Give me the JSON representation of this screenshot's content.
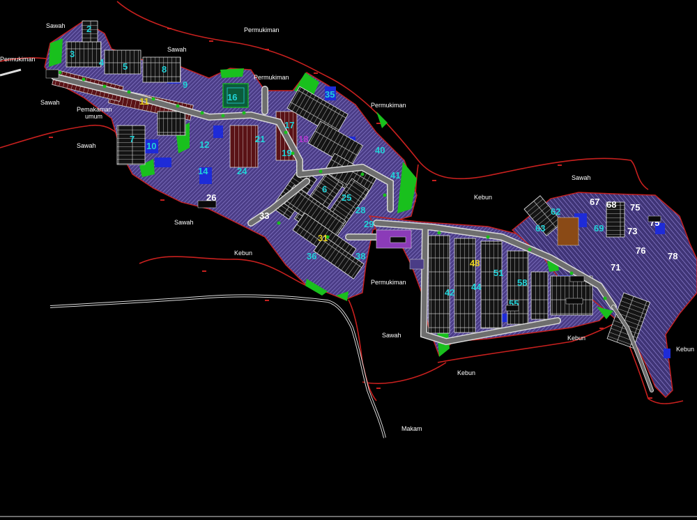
{
  "labels": {
    "sawah_1": "Sawah",
    "sawah_2": "Sawah",
    "sawah_3": "Sawah",
    "sawah_4": "Sawah",
    "sawah_5": "Sawah",
    "sawah_6": "Sawah",
    "sawah_7": "Sawah",
    "permukiman_1": "Permukiman",
    "permukiman_2": "Permukiman",
    "permukiman_3": "Permukiman",
    "permukiman_4": "Permukiman",
    "permukiman_5": "Permukiman",
    "pemakaman_line1": "Pemakaman",
    "pemakaman_line2": "umum",
    "kebun_1": "Kebun",
    "kebun_2": "Kebun",
    "kebun_3": "Kebun",
    "kebun_4": "Kebun",
    "kebun_5": "Kebun",
    "makam": "Makam"
  },
  "block_numbers": {
    "n2": "2",
    "n6": "6",
    "n10": "10",
    "n18": "18",
    "n26": "26",
    "n28": "28",
    "n33": "33",
    "n35": "35",
    "n36": "36",
    "n38": "38",
    "n55": "55",
    "n62": "62",
    "n67": "67",
    "n68": "68",
    "n71": "71",
    "n73": "73",
    "n75a": "75",
    "n75b": "75",
    "n76": "76",
    "n78": "78",
    "n11": "11",
    "n12": "12",
    "n14": "14",
    "n16": "16",
    "n17": "17",
    "n19": "19",
    "n21": "21",
    "n24": "24",
    "n25": "25",
    "n29": "29",
    "n31": "31",
    "n40": "40",
    "n41": "41",
    "n42": "42",
    "n44": "44",
    "n48": "48",
    "n51": "51",
    "n58": "58",
    "n63": "63",
    "n69": "69",
    "n8": "8",
    "n9": "9",
    "n7": "7",
    "n4": "4",
    "n3": "3",
    "n5": "5"
  },
  "colors": {
    "boundary": "#c8201e",
    "road_fill": "#6e6e6e",
    "road_edge": "#d8d8d8",
    "green": "#19c01d",
    "purple": "#6a4ea8",
    "hatch": "#7f6fc0",
    "blue": "#1e2bd8",
    "maroon": "#6a1418",
    "cyan": "#21d2d8",
    "magenta": "#b23ad0",
    "yellow": "#e8d21e",
    "white": "#ffffff"
  }
}
